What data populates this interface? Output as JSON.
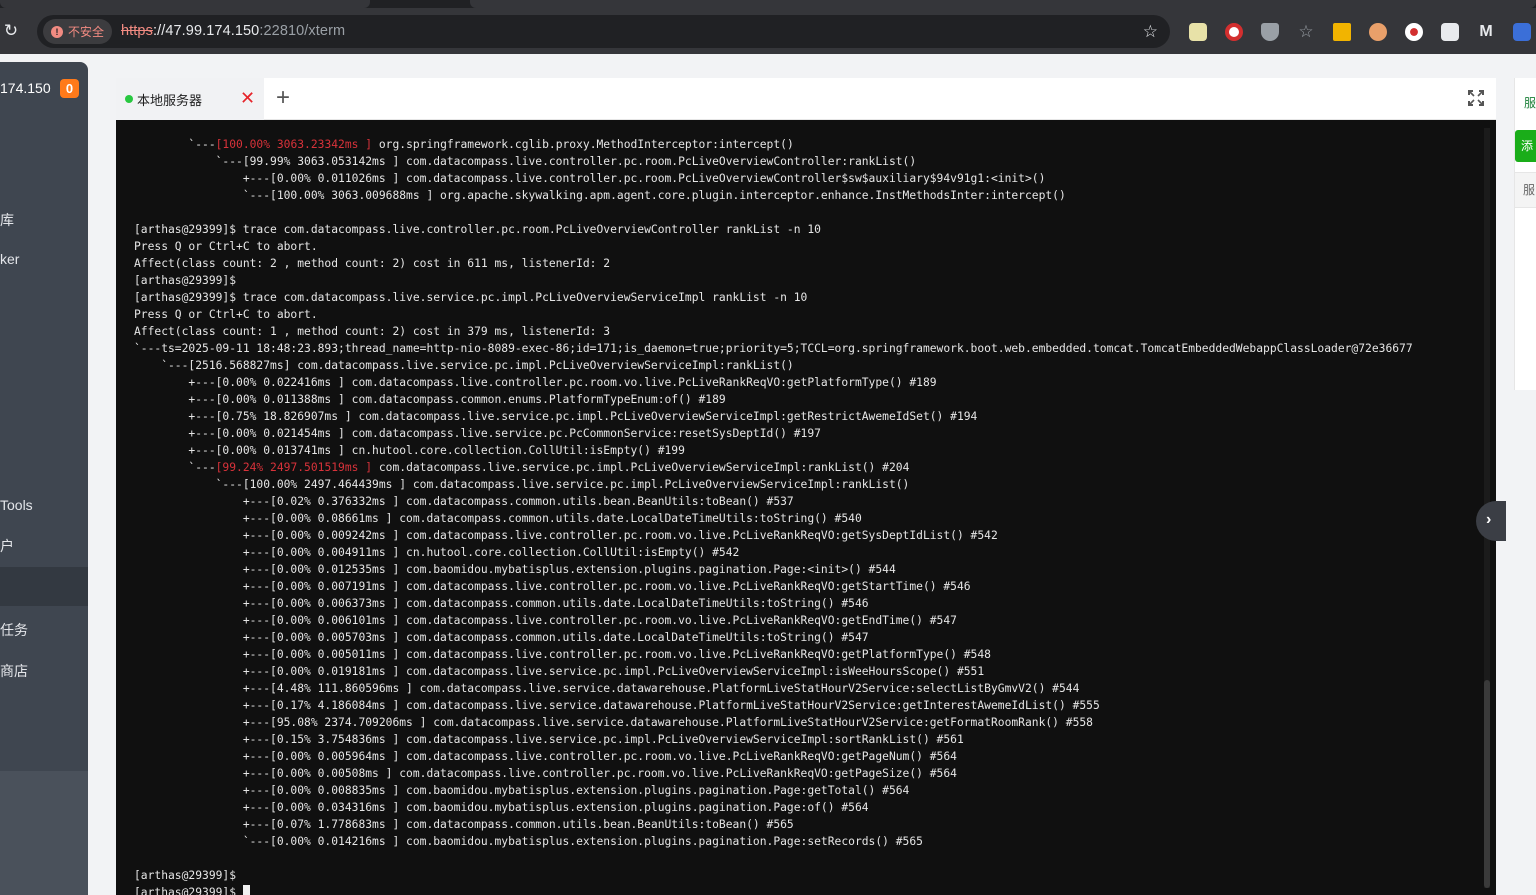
{
  "browser": {
    "security_label": "不安全",
    "url_scheme": "https",
    "url_host": "://47.99.174.150",
    "url_rest": ":22810/xterm"
  },
  "sidebar": {
    "host": "174.150",
    "badge": "0",
    "items": [
      "库",
      "ker",
      "",
      "Tools",
      "户",
      "任务",
      "商店"
    ]
  },
  "terminal_tab": {
    "label": "本地服务器",
    "close": "✕",
    "add": "+"
  },
  "right_panel": {
    "t1": "服",
    "btn": "添",
    "t2": "服"
  },
  "terminal": {
    "lines": [
      {
        "pre": "        `---",
        "hl": "[100.00% 3063.23342ms ]",
        "post": " org.springframework.cglib.proxy.MethodInterceptor:intercept()"
      },
      {
        "pre": "            `---[99.99% 3063.053142ms ] com.datacompass.live.controller.pc.room.PcLiveOverviewController:rankList()"
      },
      {
        "pre": "                +---[0.00% 0.011026ms ] com.datacompass.live.controller.pc.room.PcLiveOverviewController$sw$auxiliary$94v91g1:<init>()"
      },
      {
        "pre": "                `---[100.00% 3063.009688ms ] org.apache.skywalking.apm.agent.core.plugin.interceptor.enhance.InstMethodsInter:intercept()"
      },
      {
        "pre": ""
      },
      {
        "pre": "[arthas@29399]$ trace com.datacompass.live.controller.pc.room.PcLiveOverviewController rankList -n 10"
      },
      {
        "pre": "Press Q or Ctrl+C to abort."
      },
      {
        "pre": "Affect(class count: 2 , method count: 2) cost in 611 ms, listenerId: 2"
      },
      {
        "pre": "[arthas@29399]$"
      },
      {
        "pre": "[arthas@29399]$ trace com.datacompass.live.service.pc.impl.PcLiveOverviewServiceImpl rankList -n 10"
      },
      {
        "pre": "Press Q or Ctrl+C to abort."
      },
      {
        "pre": "Affect(class count: 1 , method count: 2) cost in 379 ms, listenerId: 3"
      },
      {
        "pre": "`---ts=2025-09-11 18:48:23.893;thread_name=http-nio-8089-exec-86;id=171;is_daemon=true;priority=5;TCCL=org.springframework.boot.web.embedded.tomcat.TomcatEmbeddedWebappClassLoader@72e36677"
      },
      {
        "pre": "    `---[2516.568827ms] com.datacompass.live.service.pc.impl.PcLiveOverviewServiceImpl:rankList()"
      },
      {
        "pre": "        +---[0.00% 0.022416ms ] com.datacompass.live.controller.pc.room.vo.live.PcLiveRankReqVO:getPlatformType() #189"
      },
      {
        "pre": "        +---[0.00% 0.011388ms ] com.datacompass.common.enums.PlatformTypeEnum:of() #189"
      },
      {
        "pre": "        +---[0.75% 18.826907ms ] com.datacompass.live.service.pc.impl.PcLiveOverviewServiceImpl:getRestrictAwemeIdSet() #194"
      },
      {
        "pre": "        +---[0.00% 0.021454ms ] com.datacompass.live.service.pc.PcCommonService:resetSysDeptId() #197"
      },
      {
        "pre": "        +---[0.00% 0.013741ms ] cn.hutool.core.collection.CollUtil:isEmpty() #199"
      },
      {
        "pre": "        `---",
        "hl": "[99.24% 2497.501519ms ]",
        "post": " com.datacompass.live.service.pc.impl.PcLiveOverviewServiceImpl:rankList() #204"
      },
      {
        "pre": "            `---[100.00% 2497.464439ms ] com.datacompass.live.service.pc.impl.PcLiveOverviewServiceImpl:rankList()"
      },
      {
        "pre": "                +---[0.02% 0.376332ms ] com.datacompass.common.utils.bean.BeanUtils:toBean() #537"
      },
      {
        "pre": "                +---[0.00% 0.08661ms ] com.datacompass.common.utils.date.LocalDateTimeUtils:toString() #540"
      },
      {
        "pre": "                +---[0.00% 0.009242ms ] com.datacompass.live.controller.pc.room.vo.live.PcLiveRankReqVO:getSysDeptIdList() #542"
      },
      {
        "pre": "                +---[0.00% 0.004911ms ] cn.hutool.core.collection.CollUtil:isEmpty() #542"
      },
      {
        "pre": "                +---[0.00% 0.012535ms ] com.baomidou.mybatisplus.extension.plugins.pagination.Page:<init>() #544"
      },
      {
        "pre": "                +---[0.00% 0.007191ms ] com.datacompass.live.controller.pc.room.vo.live.PcLiveRankReqVO:getStartTime() #546"
      },
      {
        "pre": "                +---[0.00% 0.006373ms ] com.datacompass.common.utils.date.LocalDateTimeUtils:toString() #546"
      },
      {
        "pre": "                +---[0.00% 0.006101ms ] com.datacompass.live.controller.pc.room.vo.live.PcLiveRankReqVO:getEndTime() #547"
      },
      {
        "pre": "                +---[0.00% 0.005703ms ] com.datacompass.common.utils.date.LocalDateTimeUtils:toString() #547"
      },
      {
        "pre": "                +---[0.00% 0.005011ms ] com.datacompass.live.controller.pc.room.vo.live.PcLiveRankReqVO:getPlatformType() #548"
      },
      {
        "pre": "                +---[0.00% 0.019181ms ] com.datacompass.live.service.pc.impl.PcLiveOverviewServiceImpl:isWeeHoursScope() #551"
      },
      {
        "pre": "                +---[4.48% 111.860596ms ] com.datacompass.live.service.datawarehouse.PlatformLiveStatHourV2Service:selectListByGmvV2() #544"
      },
      {
        "pre": "                +---[0.17% 4.186084ms ] com.datacompass.live.service.datawarehouse.PlatformLiveStatHourV2Service:getInterestAwemeIdList() #555"
      },
      {
        "pre": "                +---[95.08% 2374.709206ms ] com.datacompass.live.service.datawarehouse.PlatformLiveStatHourV2Service:getFormatRoomRank() #558"
      },
      {
        "pre": "                +---[0.15% 3.754836ms ] com.datacompass.live.service.pc.impl.PcLiveOverviewServiceImpl:sortRankList() #561"
      },
      {
        "pre": "                +---[0.00% 0.005964ms ] com.datacompass.live.controller.pc.room.vo.live.PcLiveRankReqVO:getPageNum() #564"
      },
      {
        "pre": "                +---[0.00% 0.00508ms ] com.datacompass.live.controller.pc.room.vo.live.PcLiveRankReqVO:getPageSize() #564"
      },
      {
        "pre": "                +---[0.00% 0.008835ms ] com.baomidou.mybatisplus.extension.plugins.pagination.Page:getTotal() #564"
      },
      {
        "pre": "                +---[0.00% 0.034316ms ] com.baomidou.mybatisplus.extension.plugins.pagination.Page:of() #564"
      },
      {
        "pre": "                +---[0.07% 1.778683ms ] com.datacompass.common.utils.bean.BeanUtils:toBean() #565"
      },
      {
        "pre": "                `---[0.00% 0.014216ms ] com.baomidou.mybatisplus.extension.plugins.pagination.Page:setRecords() #565"
      },
      {
        "pre": ""
      },
      {
        "pre": "[arthas@29399]$"
      },
      {
        "pre": "[arthas@29399]$ ",
        "cursor": true
      }
    ]
  },
  "colors": {
    "highlight": "#d8323a",
    "online_dot": "#28c840",
    "badge": "#ff7a1a"
  }
}
